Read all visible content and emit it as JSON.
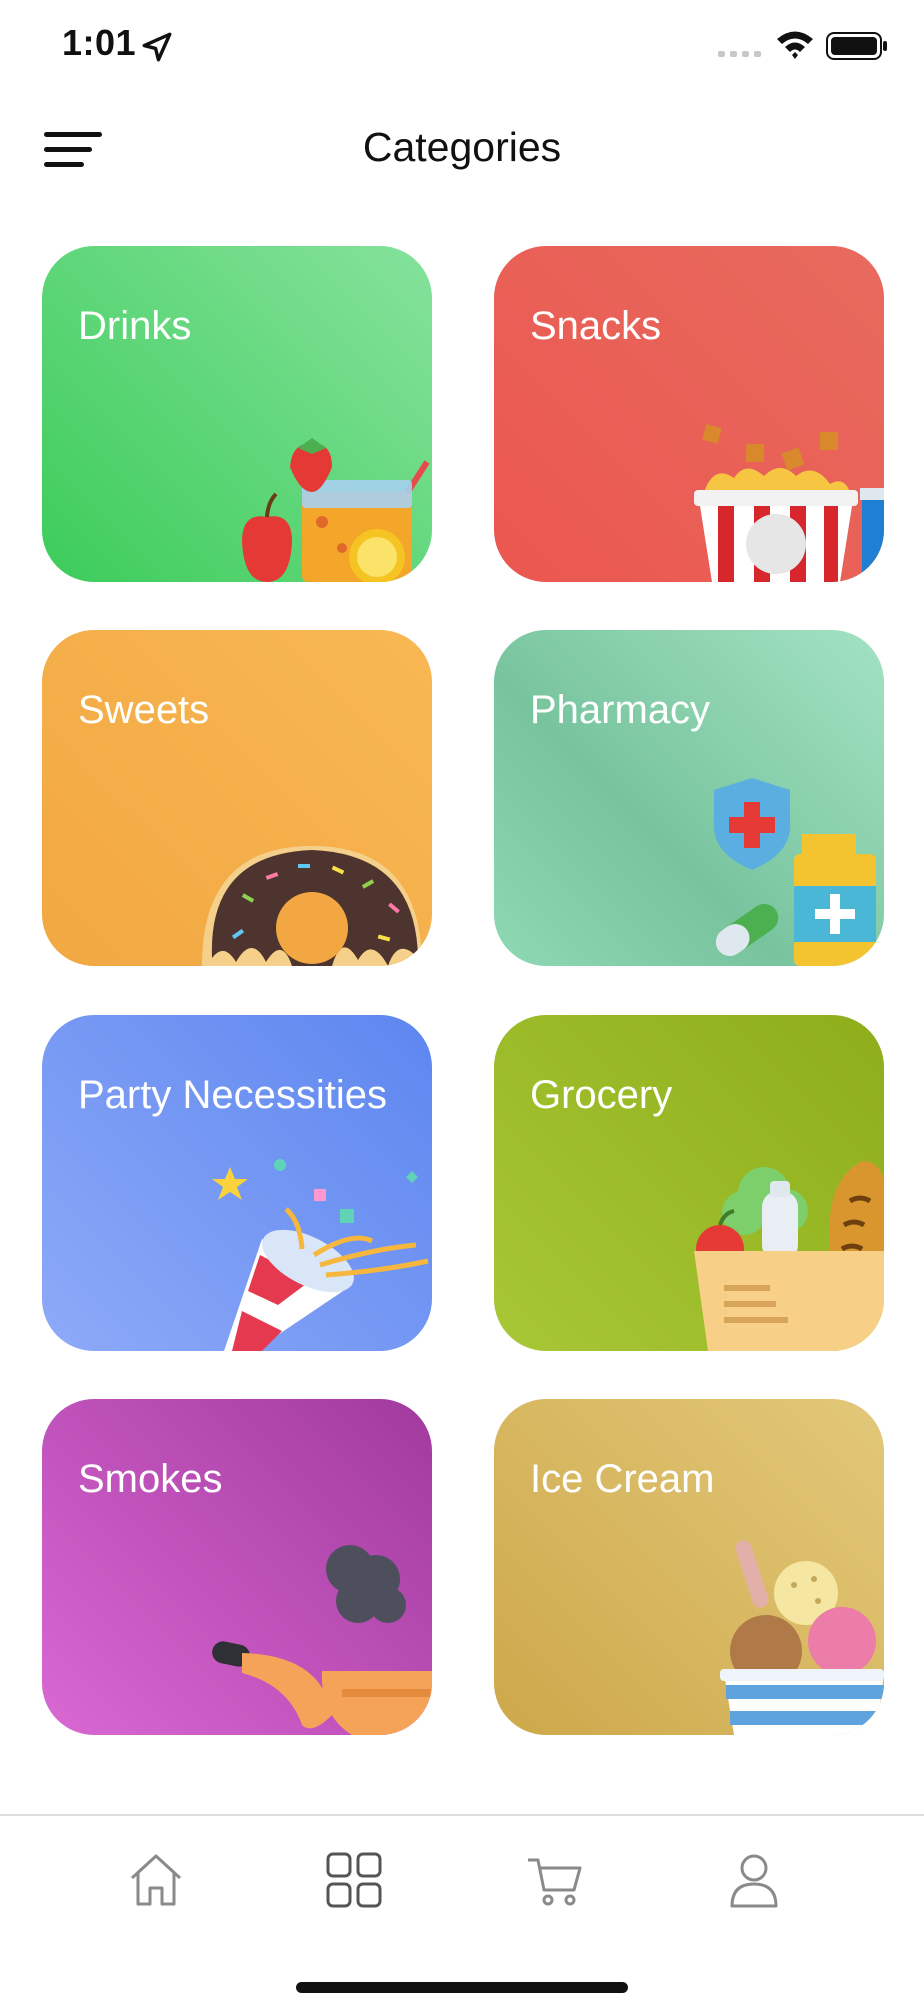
{
  "status_bar": {
    "time": "1:01",
    "icons": [
      "location-arrow-icon",
      "signal-icon",
      "wifi-icon",
      "battery-icon"
    ]
  },
  "header": {
    "title": "Categories",
    "menu_icon": "hamburger-menu-icon"
  },
  "categories": [
    {
      "label": "Drinks",
      "icon": "drink-fruit-icon",
      "colors": [
        "#86e29c",
        "#3ccc5a"
      ]
    },
    {
      "label": "Snacks",
      "icon": "popcorn-icon",
      "colors": [
        "#e86a5e",
        "#ea5750"
      ]
    },
    {
      "label": "Sweets",
      "icon": "donut-icon",
      "colors": [
        "#f8b853",
        "#f2a742"
      ]
    },
    {
      "label": "Pharmacy",
      "icon": "medicine-icon",
      "colors": [
        "#a3e2c3",
        "#78c49e"
      ]
    },
    {
      "label": "Party Necessities",
      "icon": "party-popper-icon",
      "colors": [
        "#5d86ef",
        "#8eaaf8"
      ]
    },
    {
      "label": "Grocery",
      "icon": "grocery-bag-icon",
      "colors": [
        "#8ead1a",
        "#a8c736"
      ]
    },
    {
      "label": "Smokes",
      "icon": "pipe-icon",
      "colors": [
        "#a13a9e",
        "#d968d3"
      ]
    },
    {
      "label": "Ice Cream",
      "icon": "ice-cream-icon",
      "colors": [
        "#e3c87a",
        "#cda84a"
      ]
    }
  ],
  "tab_bar": {
    "tabs": [
      {
        "icon": "home-icon",
        "active": false
      },
      {
        "icon": "grid-icon",
        "active": true
      },
      {
        "icon": "cart-icon",
        "active": false
      },
      {
        "icon": "profile-icon",
        "active": false
      }
    ],
    "icon_color": "#8a8a8a"
  }
}
